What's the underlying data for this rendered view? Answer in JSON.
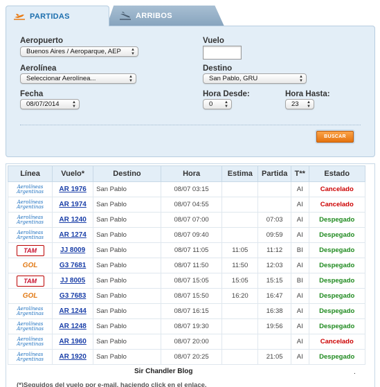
{
  "tabs": {
    "departures": "PARTIDAS",
    "arrivals": "ARRIBOS"
  },
  "form": {
    "airport_label": "Aeropuerto",
    "airport_value": "Buenos Aires / Aeroparque, AEP",
    "flight_label": "Vuelo",
    "flight_value": "",
    "airline_label": "Aerolínea",
    "airline_value": "Seleccionar Aerolínea...",
    "destination_label": "Destino",
    "destination_value": "San Pablo, GRU",
    "date_label": "Fecha",
    "date_value": "08/07/2014",
    "hour_from_label": "Hora Desde:",
    "hour_from_value": "0",
    "hour_to_label": "Hora Hasta:",
    "hour_to_value": "23",
    "search_button": "BUSCAR"
  },
  "table": {
    "headers": [
      "Línea",
      "Vuelo*",
      "Destino",
      "Hora",
      "Estima",
      "Partida",
      "T**",
      "Estado"
    ],
    "rows": [
      {
        "logo": "aerolineas",
        "logo_line1": "Aerolíneas",
        "logo_line2": "Argentinas",
        "flight": "AR 1976",
        "dest": "San Pablo",
        "time": "08/07 03:15",
        "est": "",
        "dep": "",
        "term": "AI",
        "status": "Cancelado",
        "status_color": "#cc0000"
      },
      {
        "logo": "aerolineas",
        "logo_line1": "Aerolíneas",
        "logo_line2": "Argentinas",
        "flight": "AR 1974",
        "dest": "San Pablo",
        "time": "08/07 04:55",
        "est": "",
        "dep": "",
        "term": "AI",
        "status": "Cancelado",
        "status_color": "#cc0000"
      },
      {
        "logo": "aerolineas",
        "logo_line1": "Aerolíneas",
        "logo_line2": "Argentinas",
        "flight": "AR 1240",
        "dest": "San Pablo",
        "time": "08/07 07:00",
        "est": "",
        "dep": "07:03",
        "term": "AI",
        "status": "Despegado",
        "status_color": "#1f8a1f"
      },
      {
        "logo": "aerolineas",
        "logo_line1": "Aerolíneas",
        "logo_line2": "Argentinas",
        "flight": "AR 1274",
        "dest": "San Pablo",
        "time": "08/07 09:40",
        "est": "",
        "dep": "09:59",
        "term": "AI",
        "status": "Despegado",
        "status_color": "#1f8a1f"
      },
      {
        "logo": "tam",
        "logo_text": "TAM",
        "flight": "JJ 8009",
        "dest": "San Pablo",
        "time": "08/07 11:05",
        "est": "11:05",
        "dep": "11:12",
        "term": "BI",
        "status": "Despegado",
        "status_color": "#1f8a1f"
      },
      {
        "logo": "gol",
        "logo_text": "GOL",
        "flight": "G3 7681",
        "dest": "San Pablo",
        "time": "08/07 11:50",
        "est": "11:50",
        "dep": "12:03",
        "term": "AI",
        "status": "Despegado",
        "status_color": "#1f8a1f"
      },
      {
        "logo": "tam",
        "logo_text": "TAM",
        "flight": "JJ 8005",
        "dest": "San Pablo",
        "time": "08/07 15:05",
        "est": "15:05",
        "dep": "15:15",
        "term": "BI",
        "status": "Despegado",
        "status_color": "#1f8a1f"
      },
      {
        "logo": "gol",
        "logo_text": "GOL",
        "flight": "G3 7683",
        "dest": "San Pablo",
        "time": "08/07 15:50",
        "est": "16:20",
        "dep": "16:47",
        "term": "AI",
        "status": "Despegado",
        "status_color": "#1f8a1f"
      },
      {
        "logo": "aerolineas",
        "logo_line1": "Aerolíneas",
        "logo_line2": "Argentinas",
        "flight": "AR 1244",
        "dest": "San Pablo",
        "time": "08/07 16:15",
        "est": "",
        "dep": "16:38",
        "term": "AI",
        "status": "Despegado",
        "status_color": "#1f8a1f"
      },
      {
        "logo": "aerolineas",
        "logo_line1": "Aerolíneas",
        "logo_line2": "Argentinas",
        "flight": "AR 1248",
        "dest": "San Pablo",
        "time": "08/07 19:30",
        "est": "",
        "dep": "19:56",
        "term": "AI",
        "status": "Despegado",
        "status_color": "#1f8a1f"
      },
      {
        "logo": "aerolineas",
        "logo_line1": "Aerolíneas",
        "logo_line2": "Argentinas",
        "flight": "AR 1960",
        "dest": "San Pablo",
        "time": "08/07 20:00",
        "est": "",
        "dep": "",
        "term": "AI",
        "status": "Cancelado",
        "status_color": "#cc0000"
      },
      {
        "logo": "aerolineas",
        "logo_line1": "Aerolíneas",
        "logo_line2": "Argentinas",
        "flight": "AR 1920",
        "dest": "San Pablo",
        "time": "08/07 20:25",
        "est": "",
        "dep": "21:05",
        "term": "AI",
        "status": "Despegado",
        "status_color": "#1f8a1f"
      }
    ]
  },
  "footer": {
    "blog": "Sir Chandler Blog",
    "dot": ".",
    "note": "(*)Seguidos del vuelo por e-mail, haciendo click en el enlace."
  }
}
